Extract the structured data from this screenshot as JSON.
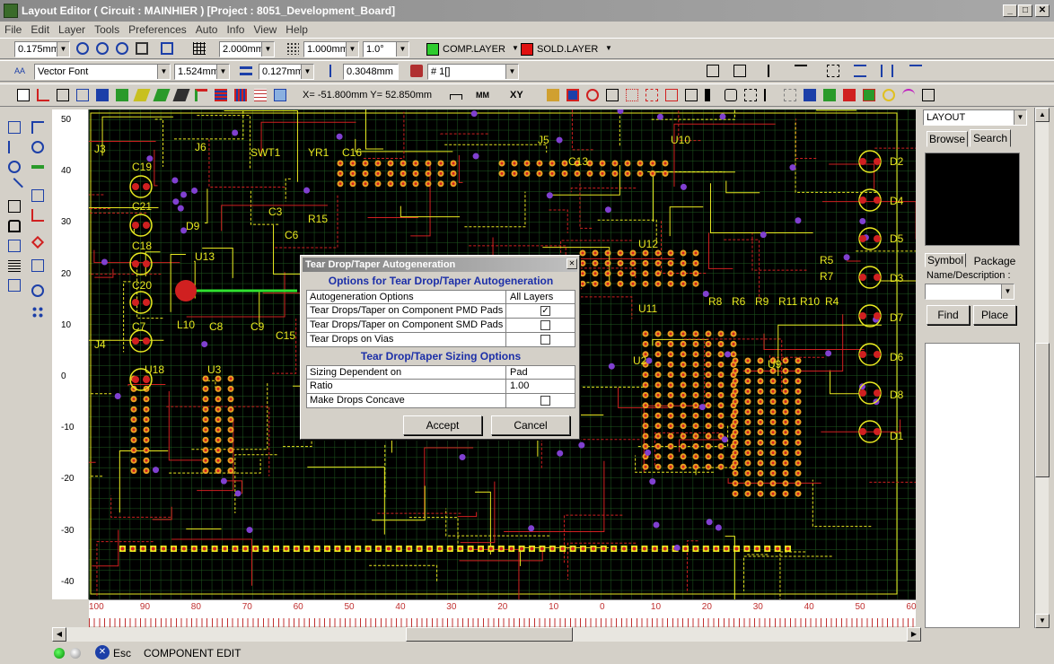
{
  "window": {
    "title": "Layout Editor ( Circuit : MAINHIER ) [Project : 8051_Development_Board]",
    "min": "_",
    "max": "□",
    "close": "✕"
  },
  "menu": [
    "File",
    "Edit",
    "Layer",
    "Tools",
    "Preferences",
    "Auto",
    "Info",
    "View",
    "Help"
  ],
  "toolbar1": {
    "grid_snap": "0.175mm",
    "grid_size": "2.000mm",
    "line_width": "1.000mm",
    "angle": "1.0°",
    "comp_layer": "COMP.LAYER",
    "sold_layer": "SOLD.LAYER",
    "comp_color": "#2ecc2e",
    "sold_color": "#e01010"
  },
  "toolbar2": {
    "font": "Vector Font",
    "text_size": "1.524mm",
    "line_size": "0.127mm",
    "pad_size": "0.3048mm",
    "net": "# 1[]"
  },
  "toolbar3": {
    "coords": "X= -51.800mm   Y= 52.850mm",
    "units": "MM",
    "xy": "XY"
  },
  "rulers": {
    "left": [
      "50",
      "40",
      "30",
      "20",
      "10",
      "0",
      "-10",
      "-20",
      "-30",
      "-40"
    ],
    "bottom": [
      "100",
      "90",
      "80",
      "70",
      "60",
      "50",
      "40",
      "30",
      "20",
      "10",
      "0",
      "10",
      "20",
      "30",
      "40",
      "50",
      "60"
    ]
  },
  "board_labels": [
    "J3",
    "J6",
    "SWT1",
    "YR1",
    "C16",
    "J5",
    "U10",
    "C19",
    "C21",
    "C18",
    "C20",
    "D9",
    "C3",
    "R15",
    "C6",
    "C7",
    "U13",
    "C8",
    "C9",
    "C15",
    "J4",
    "U18",
    "U3",
    "L10",
    "C13",
    "U12",
    "R5",
    "R7",
    "R8",
    "R6",
    "R9",
    "R11",
    "R10",
    "R4",
    "U11",
    "U2",
    "U9",
    "D2",
    "D4",
    "D5",
    "D3",
    "D7",
    "D6",
    "D8",
    "D1"
  ],
  "dialog": {
    "title": "Tear Drop/Taper Autogeneration",
    "close": "✕",
    "section1": "Options for Tear Drop/Taper Autogeneration",
    "rows1": [
      {
        "label": "Autogeneration Options",
        "value": "All Layers"
      },
      {
        "label": "Tear Drops/Taper on Component PMD Pads",
        "checked": true
      },
      {
        "label": "Tear Drops/Taper on Component SMD Pads",
        "checked": false
      },
      {
        "label": "Tear Drops on Vias",
        "checked": false
      }
    ],
    "section2": "Tear Drop/Taper Sizing Options",
    "rows2": [
      {
        "label": "Sizing Dependent on",
        "value": "Pad"
      },
      {
        "label": "Ratio",
        "value": "1.00"
      },
      {
        "label": "Make Drops Concave",
        "checked": false
      }
    ],
    "accept": "Accept",
    "cancel": "Cancel"
  },
  "rightpanel": {
    "mode": "LAYOUT",
    "tab_browse": "Browse",
    "tab_search": "Search",
    "tab_symbol": "Symbol",
    "tab_package": "Package",
    "name_desc": "Name/Description :",
    "find": "Find",
    "place": "Place"
  },
  "status": {
    "esc": "Esc",
    "mode": "COMPONENT EDIT"
  }
}
